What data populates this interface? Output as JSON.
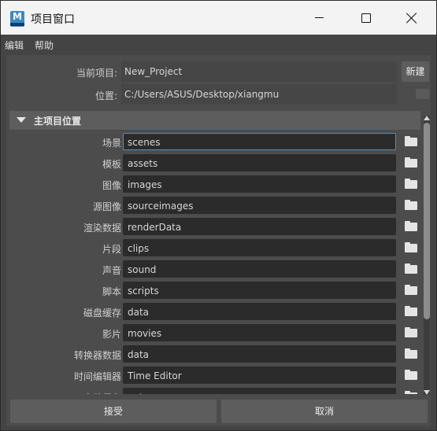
{
  "window": {
    "title": "项目窗口",
    "app_icon_letter": "M",
    "app_icon_color": "#3a88c7"
  },
  "menu": [
    "编辑",
    "帮助"
  ],
  "project": {
    "current_label": "当前项目:",
    "current_value": "New_Project",
    "new_button": "新建",
    "location_label": "位置:",
    "location_value": "C:/Users/ASUS/Desktop/xiangmu"
  },
  "section": {
    "title": "主项目位置"
  },
  "locations": [
    {
      "label": "场景",
      "value": "scenes",
      "focused": true
    },
    {
      "label": "模板",
      "value": "assets"
    },
    {
      "label": "图像",
      "value": "images"
    },
    {
      "label": "源图像",
      "value": "sourceimages"
    },
    {
      "label": "渲染数据",
      "value": "renderData"
    },
    {
      "label": "片段",
      "value": "clips"
    },
    {
      "label": "声音",
      "value": "sound"
    },
    {
      "label": "脚本",
      "value": "scripts"
    },
    {
      "label": "磁盘缓存",
      "value": "data"
    },
    {
      "label": "影片",
      "value": "movies"
    },
    {
      "label": "转换器数据",
      "value": "data"
    },
    {
      "label": "时间编辑器",
      "value": "Time Editor"
    },
    {
      "label": "自动保存",
      "value": "autosave"
    }
  ],
  "buttons": {
    "accept": "接受",
    "cancel": "取消"
  },
  "icons": {
    "folder": "folder-icon",
    "section_toggle": "triangle-down-icon"
  }
}
